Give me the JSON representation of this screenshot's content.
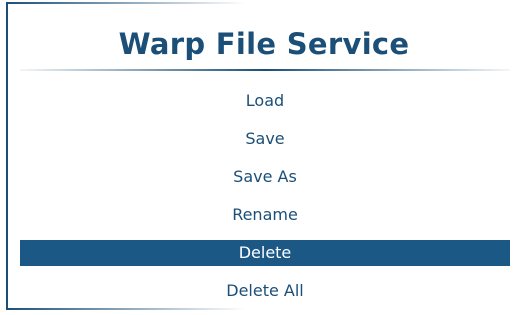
{
  "dialog": {
    "title": "Warp File Service"
  },
  "menu": {
    "items": [
      {
        "label": "Load"
      },
      {
        "label": "Save"
      },
      {
        "label": "Save As"
      },
      {
        "label": "Rename"
      },
      {
        "label": "Delete",
        "selected": true
      },
      {
        "label": "Delete All"
      }
    ],
    "selected_index": 4
  },
  "colors": {
    "accent": "#1b4f78",
    "selection_background": "#1b5886",
    "selection_text": "#ffffff",
    "background": "#ffffff"
  }
}
